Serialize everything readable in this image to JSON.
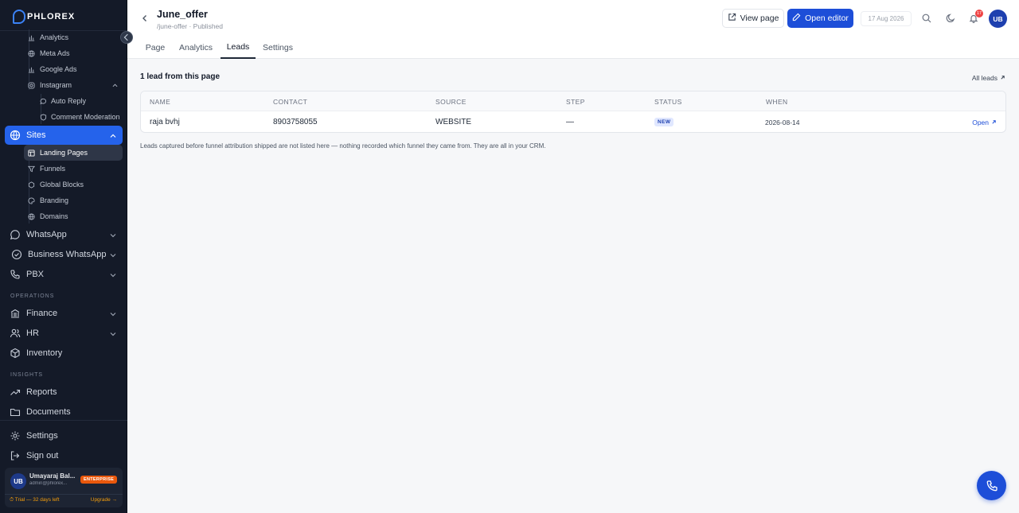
{
  "brand": {
    "logo_text": "PHLOREX"
  },
  "sidebar": {
    "marketing_items": [
      {
        "label": "Analytics",
        "icon": "bar-chart-icon"
      },
      {
        "label": "Meta Ads",
        "icon": "globe-icon"
      },
      {
        "label": "Google Ads",
        "icon": "bar-chart-icon"
      },
      {
        "label": "Instagram",
        "icon": "instagram-icon"
      }
    ],
    "instagram_items": [
      {
        "label": "Auto Reply",
        "icon": "message-icon"
      },
      {
        "label": "Comment Moderation",
        "icon": "shield-icon"
      }
    ],
    "sites": {
      "label": "Sites",
      "icon": "globe-icon"
    },
    "sites_items": [
      {
        "label": "Landing Pages",
        "icon": "layout-icon"
      },
      {
        "label": "Funnels",
        "icon": "funnel-icon"
      },
      {
        "label": "Global Blocks",
        "icon": "blocks-icon"
      },
      {
        "label": "Branding",
        "icon": "palette-icon"
      },
      {
        "label": "Domains",
        "icon": "globe-icon"
      }
    ],
    "channels": [
      {
        "label": "WhatsApp",
        "icon": "whatsapp-icon"
      },
      {
        "label": "Business WhatsApp",
        "icon": "check-circle-icon"
      },
      {
        "label": "PBX",
        "icon": "phone-icon"
      }
    ],
    "operations_label": "OPERATIONS",
    "operations": [
      {
        "label": "Finance",
        "icon": "bank-icon"
      },
      {
        "label": "HR",
        "icon": "users-icon"
      },
      {
        "label": "Inventory",
        "icon": "box-icon"
      }
    ],
    "insights_label": "INSIGHTS",
    "insights": [
      {
        "label": "Reports",
        "icon": "trend-icon"
      },
      {
        "label": "Documents",
        "icon": "folder-icon"
      }
    ],
    "settings_label": "Settings",
    "signout_label": "Sign out",
    "user": {
      "initials": "UB",
      "name": "Umayaraj Bal...",
      "email": "admin@phlorex...",
      "plan": "ENTERPRISE",
      "trial": "⏱ Trial — 32 days left",
      "upgrade": "Upgrade →"
    }
  },
  "header": {
    "title": "June_offer",
    "subtitle": "/june-offer · Published",
    "view_page": "View page",
    "open_editor": "Open editor",
    "date": "17 Aug 2026",
    "notification_count": "17",
    "avatar_initials": "UB"
  },
  "tabs": [
    "Page",
    "Analytics",
    "Leads",
    "Settings"
  ],
  "active_tab": "Leads",
  "leads": {
    "heading": "1 lead from this page",
    "all_leads": "All leads",
    "columns": [
      "NAME",
      "CONTACT",
      "SOURCE",
      "STEP",
      "STATUS",
      "WHEN"
    ],
    "rows": [
      {
        "name": "raja bvhj",
        "contact": "8903758055",
        "source": "WEBSITE",
        "step": "—",
        "status": "NEW",
        "when": "2026-08-14",
        "action": "Open"
      }
    ],
    "note": "Leads captured before funnel attribution shipped are not listed here — nothing recorded which funnel they came from. They are all in your CRM."
  },
  "colors": {
    "sidebar_bg": "#141a28",
    "accent": "#2563eb",
    "primary_button": "#1d4ed8",
    "plan_badge": "#ea580c",
    "notification": "#ef4444"
  }
}
